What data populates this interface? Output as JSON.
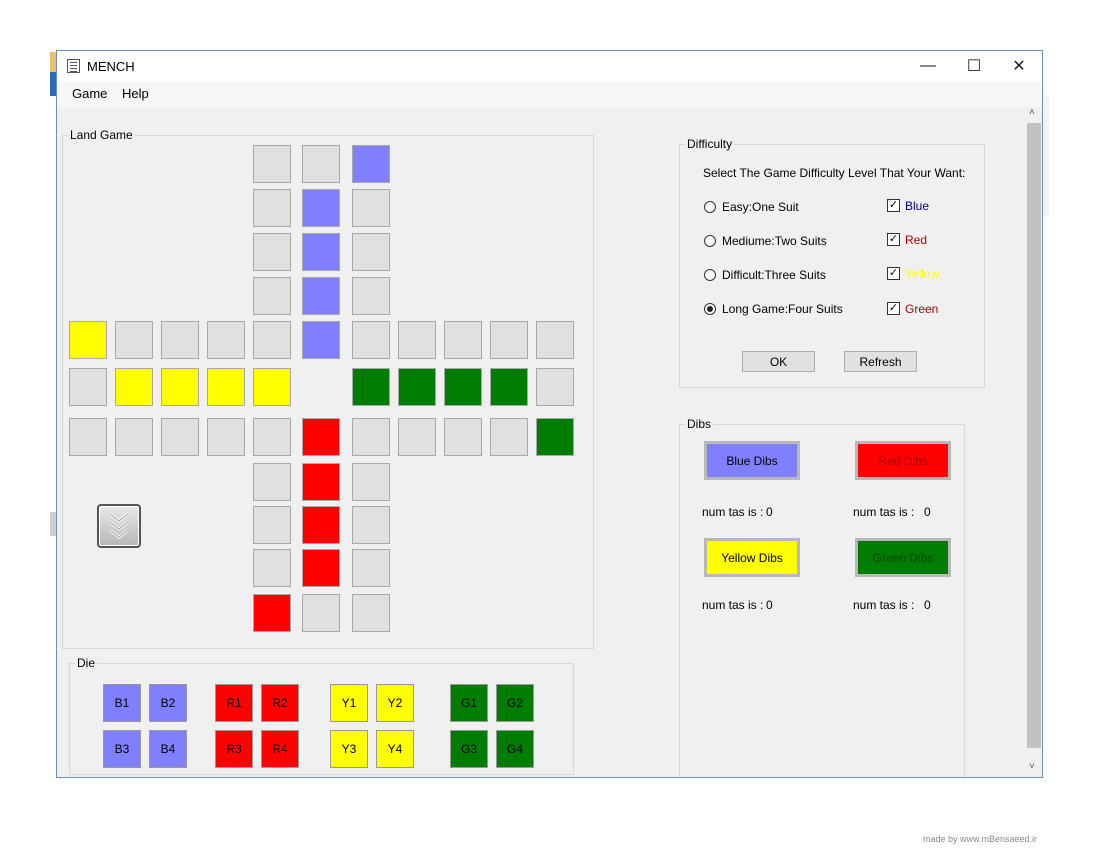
{
  "window": {
    "title": "MENCH",
    "icon": "notepad-icon",
    "controls": {
      "minimize": "—",
      "maximize": "☐",
      "close": "✕"
    }
  },
  "menu": {
    "game": "Game",
    "help": "Help"
  },
  "board": {
    "legend": "Land Game",
    "rows": [
      [
        "",
        "",
        "",
        "",
        "grey",
        "grey",
        "blue",
        "",
        "",
        "",
        ""
      ],
      [
        "",
        "",
        "",
        "",
        "grey",
        "blue",
        "grey",
        "",
        "",
        "",
        ""
      ],
      [
        "",
        "",
        "",
        "",
        "grey",
        "blue",
        "grey",
        "",
        "",
        "",
        ""
      ],
      [
        "",
        "",
        "",
        "",
        "grey",
        "blue",
        "grey",
        "",
        "",
        "",
        ""
      ],
      [
        "yellow",
        "grey",
        "grey",
        "grey",
        "grey",
        "blue",
        "grey",
        "grey",
        "grey",
        "grey",
        "grey"
      ],
      [
        "grey",
        "yellow",
        "yellow",
        "yellow",
        "yellow",
        "",
        "green",
        "green",
        "green",
        "green",
        "grey"
      ],
      [
        "grey",
        "grey",
        "grey",
        "grey",
        "grey",
        "red",
        "grey",
        "grey",
        "grey",
        "grey",
        "green"
      ],
      [
        "",
        "",
        "",
        "",
        "grey",
        "red",
        "grey",
        "",
        "",
        "",
        ""
      ],
      [
        "",
        "",
        "",
        "",
        "grey",
        "red",
        "grey",
        "",
        "",
        "",
        ""
      ],
      [
        "",
        "",
        "",
        "",
        "grey",
        "red",
        "grey",
        "",
        "",
        "",
        ""
      ],
      [
        "",
        "",
        "",
        "",
        "red",
        "grey",
        "grey",
        "",
        "",
        "",
        ""
      ]
    ],
    "piece_icon": "triple-chevron-down-icon"
  },
  "die": {
    "legend": "Die",
    "groups": [
      {
        "color": "#8080ff",
        "text_color": "#000000",
        "labels": [
          "B1",
          "B2",
          "B3",
          "B4"
        ]
      },
      {
        "color": "#ff0000",
        "text_color": "#000000",
        "labels": [
          "R1",
          "R2",
          "R3",
          "R4"
        ]
      },
      {
        "color": "#ffff00",
        "text_color": "#000000",
        "labels": [
          "Y1",
          "Y2",
          "Y3",
          "Y4"
        ]
      },
      {
        "color": "#007c00",
        "text_color": "#000000",
        "labels": [
          "G1",
          "G2",
          "G3",
          "G4"
        ]
      }
    ]
  },
  "difficulty": {
    "legend": "Difficulty",
    "prompt": "Select The Game Difficulty Level That Your Want:",
    "options": [
      {
        "label": "Easy:One Suit",
        "selected": false
      },
      {
        "label": "Mediume:Two Suits",
        "selected": false
      },
      {
        "label": "Difficult:Three Suits",
        "selected": false
      },
      {
        "label": "Long Game:Four Suits",
        "selected": true
      }
    ],
    "colors": [
      {
        "label": "Blue",
        "checked": true,
        "color": "#00008b"
      },
      {
        "label": "Red",
        "checked": true,
        "color": "#b00000"
      },
      {
        "label": "Yellow",
        "checked": true,
        "color": "#ffff00"
      },
      {
        "label": "Green",
        "checked": true,
        "color": "#b00000"
      }
    ],
    "ok": "OK",
    "refresh": "Refresh"
  },
  "dibs": {
    "legend": "Dibs",
    "items": [
      {
        "label": "Blue Dibs",
        "bg": "#8080ff",
        "fg": "#000000",
        "count_label": "num tas is :",
        "count": "0"
      },
      {
        "label": "Red Dibs",
        "bg": "#ff0000",
        "fg": "#b00000",
        "count_label": "num tas is :",
        "count": "0"
      },
      {
        "label": "Yellow Dibs",
        "bg": "#ffff00",
        "fg": "#000000",
        "count_label": "num tas is :",
        "count": "0"
      },
      {
        "label": "Green Dibs",
        "bg": "#007c00",
        "fg": "#004800",
        "count_label": "num tas is :",
        "count": "0"
      }
    ]
  },
  "scrollbar": {
    "up": "˄",
    "down": "˅"
  },
  "credit": "made by www.mBensaeed.ir"
}
